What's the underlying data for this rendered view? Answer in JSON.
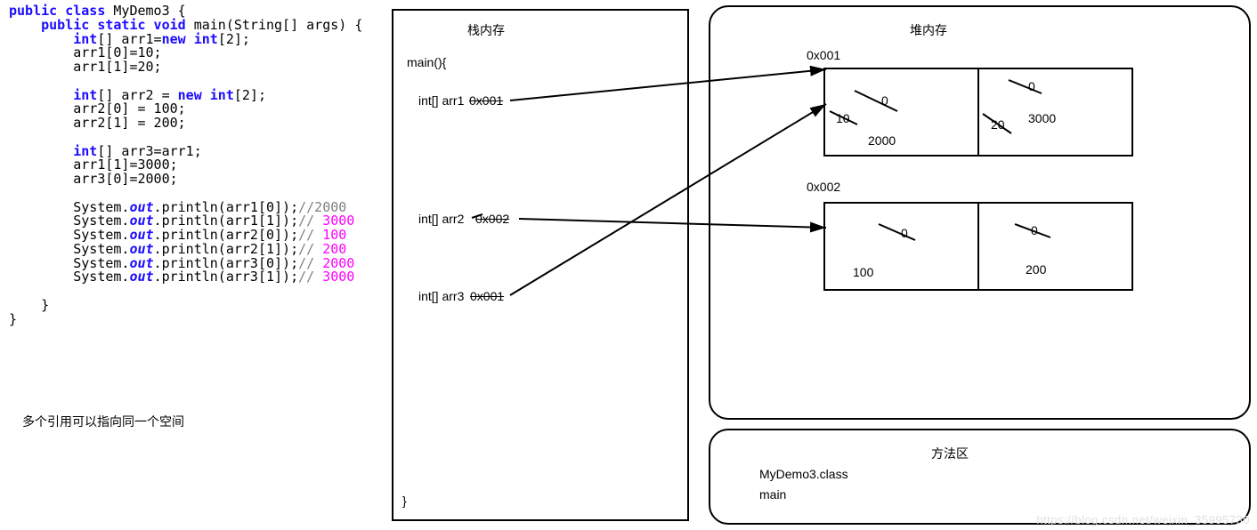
{
  "code": {
    "class_decl_pre": "public class",
    "class_name": " MyDemo3 {",
    "main_sig_pre": "    public static void",
    "main_sig_post": " main(String[] args) {",
    "l_arr1_decl_pre": "        int",
    "l_arr1_decl_mid": "[] arr1=",
    "l_arr1_decl_new": "new int",
    "l_arr1_decl_post": "[2];",
    "l_arr1_0": "        arr1[0]=10;",
    "l_arr1_1": "        arr1[1]=20;",
    "l_blank": " ",
    "l_arr2_decl_pre": "        int",
    "l_arr2_decl_mid": "[] arr2 = ",
    "l_arr2_decl_new": "new int",
    "l_arr2_decl_post": "[2];",
    "l_arr2_0": "        arr2[0] = 100;",
    "l_arr2_1": "        arr2[1] = 200;",
    "l_arr3_decl_pre": "        int",
    "l_arr3_decl_post": "[] arr3=arr1;",
    "l_arr1_1b": "        arr1[1]=3000;",
    "l_arr3_0": "        arr3[0]=2000;",
    "p1_pre": "        System.",
    "p_out": "out",
    "p1_mid": ".println(arr1[0]);",
    "p1_cmt": "//2000",
    "p2_mid": ".println(arr1[1]);",
    "p2_cmt": "// ",
    "p2_num": "3000",
    "p3_mid": ".println(arr2[0]);",
    "p3_num": "100",
    "p4_mid": ".println(arr2[1]);",
    "p4_num": "200",
    "p5_mid": ".println(arr3[0]);",
    "p5_num": "2000",
    "p6_mid": ".println(arr3[1]);",
    "p6_num": "3000",
    "close_inner": "    }",
    "close_outer": "}"
  },
  "note": "多个引用可以指向同一个空间",
  "stack": {
    "title": "栈内存",
    "main_open": "main(){",
    "arr1_label": "int[] arr1 ",
    "arr1_addr": "0x001",
    "arr2_label": "int[] arr2 ",
    "arr2_addr": "0x002",
    "arr3_label": "int[] arr3 ",
    "arr3_addr": "0x001",
    "close": "}"
  },
  "heap": {
    "title": "堆内存",
    "addr1": "0x001",
    "arr1_cell0_old1": "0",
    "arr1_cell0_old2": "10",
    "arr1_cell0_val": "2000",
    "arr1_cell1_old1": "0",
    "arr1_cell1_old2": "20",
    "arr1_cell1_val": "3000",
    "addr2": "0x002",
    "arr2_cell0_old": "0",
    "arr2_cell0_val": "100",
    "arr2_cell1_old": "0",
    "arr2_cell1_val": "200"
  },
  "method_area": {
    "title": "方法区",
    "l1": "MyDemo3.class",
    "l2": "main"
  },
  "watermark": "https://blog.csdn.net/weixin_35995730"
}
